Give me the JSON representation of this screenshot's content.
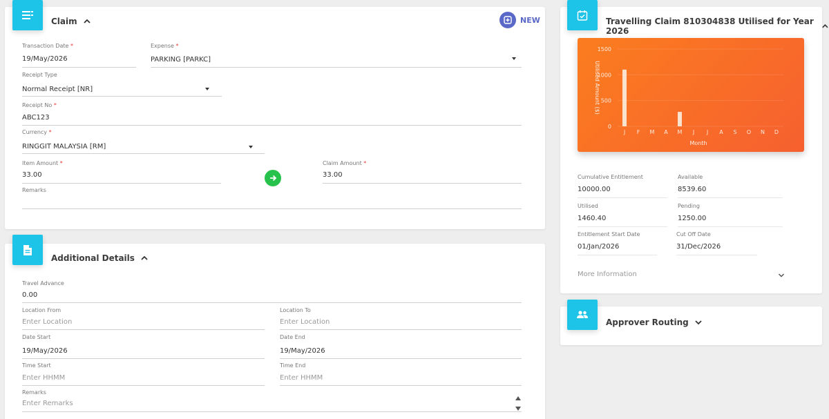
{
  "claim": {
    "title": "Claim",
    "new_label": "NEW",
    "transaction_date_label": "Transaction Date",
    "transaction_date_value": "19/May/2026",
    "expense_label": "Expense",
    "expense_value": "PARKING [PARKC]",
    "receipt_type_label": "Receipt Type",
    "receipt_type_value": "Normal Receipt [NR]",
    "receipt_no_label": "Receipt No",
    "receipt_no_value": "ABC123",
    "currency_label": "Currency",
    "currency_value": "RINGGIT MALAYSIA [RM]",
    "item_amount_label": "Item Amount",
    "item_amount_value": "33.00",
    "claim_amount_label": "Claim Amount",
    "claim_amount_value": "33.00",
    "remarks_label": "Remarks",
    "remarks_value": ""
  },
  "additional": {
    "title": "Additional Details",
    "travel_advance_label": "Travel Advance",
    "travel_advance_value": "0.00",
    "location_from_label": "Location From",
    "location_from_placeholder": "Enter Location",
    "location_to_label": "Location To",
    "location_to_placeholder": "Enter Location",
    "date_start_label": "Date Start",
    "date_start_value": "19/May/2026",
    "date_end_label": "Date End",
    "date_end_value": "19/May/2026",
    "time_start_label": "Time Start",
    "time_start_placeholder": "Enter HHMM",
    "time_end_label": "Time End",
    "time_end_placeholder": "Enter HHMM",
    "remarks_label": "Remarks",
    "remarks_placeholder": "Enter Remarks"
  },
  "travelling": {
    "title": "Travelling Claim 810304838 Utilised for Year 2026",
    "cumulative_label": "Cumulative Entitlement",
    "cumulative_value": "10000.00",
    "available_label": "Available",
    "available_value": "8539.60",
    "utilised_label": "Utilised",
    "utilised_value": "1460.40",
    "pending_label": "Pending",
    "pending_value": "1250.00",
    "start_date_label": "Entitlement Start Date",
    "start_date_value": "01/Jan/2026",
    "cutoff_label": "Cut Off Date",
    "cutoff_value": "31/Dec/2026",
    "more_info_label": "More Information"
  },
  "approver": {
    "title": "Approver Routing"
  },
  "chart_data": {
    "type": "bar",
    "categories": [
      "J",
      "F",
      "M",
      "A",
      "M",
      "J",
      "J",
      "A",
      "S",
      "O",
      "N",
      "D"
    ],
    "values": [
      1100,
      0,
      0,
      0,
      280,
      0,
      0,
      0,
      0,
      0,
      0,
      0
    ],
    "xlabel": "Month",
    "ylabel": "Utilised Amount ($)",
    "yticks": [
      0,
      500,
      1000,
      1500
    ],
    "ylim": [
      0,
      1500
    ],
    "grid": true
  },
  "colors": {
    "accent": "#1ec3e8",
    "new_button": "#5a68c7",
    "go_button": "#27c24c",
    "chart_bg": "#f7692a",
    "required": "#e53935"
  }
}
